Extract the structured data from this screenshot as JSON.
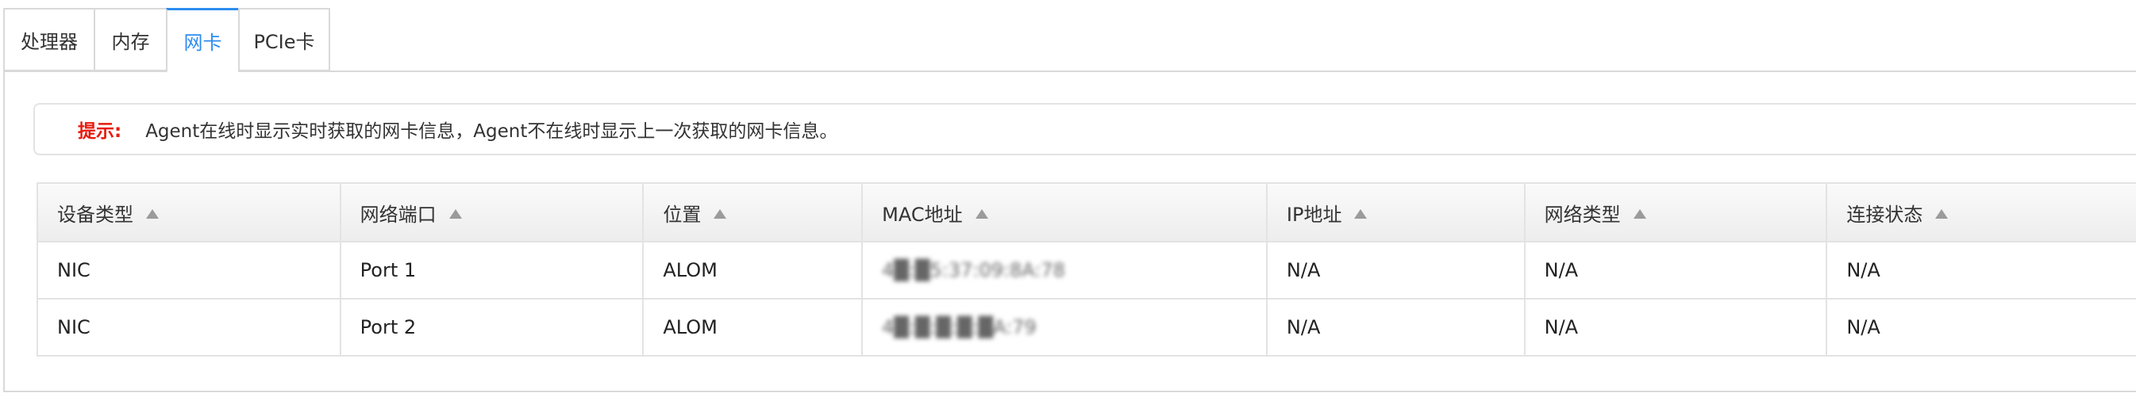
{
  "tabs": [
    {
      "label": "处理器",
      "active": false
    },
    {
      "label": "内存",
      "active": false
    },
    {
      "label": "网卡",
      "active": true
    },
    {
      "label": "PCIe卡",
      "active": false
    }
  ],
  "hint": {
    "label": "提示:",
    "text": "Agent在线时显示实时获取的网卡信息，Agent不在线时显示上一次获取的网卡信息。"
  },
  "table": {
    "columns": [
      "设备类型",
      "网络端口",
      "位置",
      "MAC地址",
      "IP地址",
      "网络类型",
      "连接状态"
    ],
    "rows": [
      [
        "NIC",
        "Port 1",
        "ALOM",
        "4█:█5:37:09:8A:78",
        "N/A",
        "N/A",
        "N/A"
      ],
      [
        "NIC",
        "Port 2",
        "ALOM",
        "4█:█:█:█:█A:79",
        "N/A",
        "N/A",
        "N/A"
      ]
    ]
  },
  "colors": {
    "accent": "#2d8cf0",
    "hint_label": "#e8190d",
    "border": "#d9d9d9"
  },
  "icons": {
    "sort": "sort-ascending-icon"
  }
}
